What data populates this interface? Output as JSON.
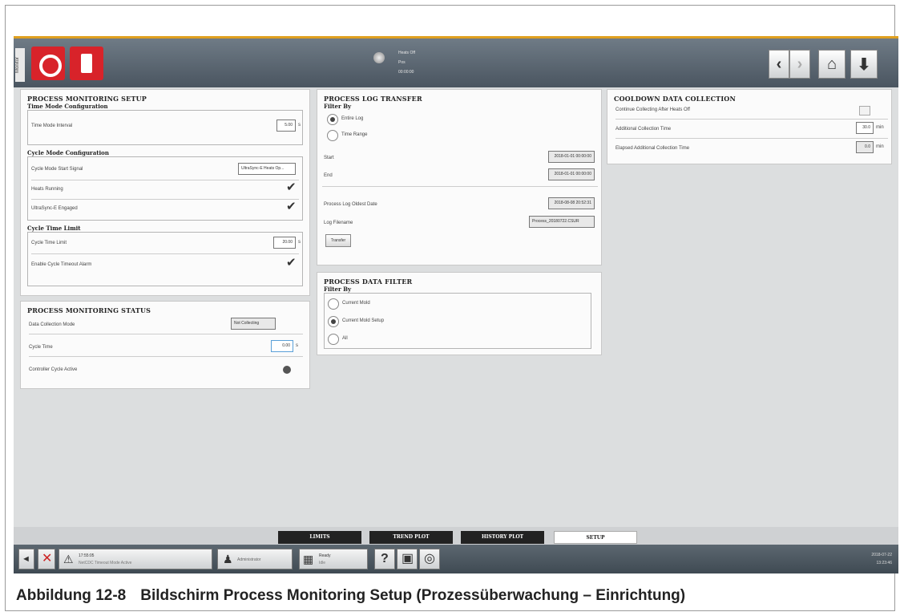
{
  "topbar": {
    "side_tab": "Monitor",
    "status_lines": [
      "Heats Off",
      "Pos",
      "00:00:00"
    ]
  },
  "setup_panel": {
    "title": "PROCESS MONITORING SETUP",
    "time_mode_header": "Time Mode Configuration",
    "time_mode_interval_label": "Time Mode Interval",
    "time_mode_interval_value": "5.00",
    "time_mode_interval_unit": "s",
    "cycle_mode_header": "Cycle Mode Configuration",
    "cycle_start_signal_label": "Cycle Mode Start Signal",
    "cycle_start_signal_value": "UltraSync-E Heats Op...",
    "heats_running_label": "Heats Running",
    "ultrasync_engaged_label": "UltraSync-E Engaged",
    "cycle_time_limit_header": "Cycle Time Limit",
    "cycle_time_limit_label": "Cycle Time Limit",
    "cycle_time_limit_value": "20.00",
    "cycle_time_limit_unit": "s",
    "enable_timeout_label": "Enable Cycle Timeout Alarm"
  },
  "status_panel": {
    "title": "PROCESS MONITORING STATUS",
    "data_collection_mode_label": "Data Collection Mode",
    "data_collection_mode_value": "Not Collecting",
    "cycle_time_label": "Cycle Time",
    "cycle_time_value": "0.00",
    "cycle_time_unit": "s",
    "controller_cycle_active_label": "Controller Cycle Active"
  },
  "log_transfer_panel": {
    "title": "PROCESS LOG TRANSFER",
    "filter_header": "Filter By",
    "entire_log_label": "Entire Log",
    "time_range_label": "Time Range",
    "start_label": "Start",
    "start_value": "2018-01-01 00:00:00",
    "end_label": "End",
    "end_value": "2018-01-01 00:00:00",
    "oldest_date_label": "Process Log Oldest Date",
    "oldest_date_value": "2018-08-08 20:52:31",
    "log_filename_label": "Log Filename",
    "log_filename_value": "Process_20180722.CSUR",
    "transfer_button": "Transfer"
  },
  "data_filter_panel": {
    "title": "PROCESS DATA FILTER",
    "filter_header": "Filter By",
    "current_mold_label": "Current Mold",
    "current_mold_setup_label": "Current Mold Setup",
    "all_label": "All"
  },
  "cooldown_panel": {
    "title": "COOLDOWN DATA COLLECTION",
    "continue_collecting_label": "Continue Collecting After Heats Off",
    "additional_time_label": "Additional Collection Time",
    "additional_time_value": "30.0",
    "additional_time_unit": "min",
    "elapsed_time_label": "Elapsed Additional Collection Time",
    "elapsed_time_value": "0.0",
    "elapsed_time_unit": "min"
  },
  "tabs": [
    "LIMITS",
    "TREND PLOT",
    "HISTORY PLOT",
    "SETUP"
  ],
  "statusbar": {
    "alarm_time": "17:55:05",
    "alarm_text": "NetCDC Timeout Mode Active",
    "user_label": "Administrator",
    "ready_label": "Ready",
    "ready_sub": "Idle",
    "date": "2018-07-22",
    "time": "13:23:46"
  },
  "caption": {
    "number": "Abbildung 12-8",
    "text": "Bildschirm Process Monitoring Setup (Prozessüberwachung – Einrichtung)"
  }
}
